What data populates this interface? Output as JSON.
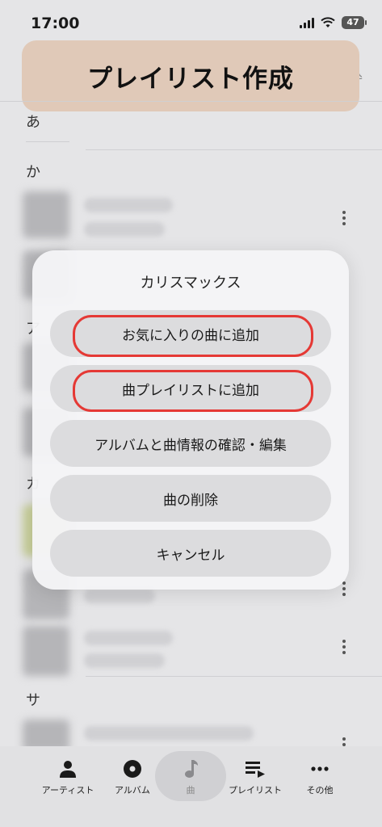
{
  "status_bar": {
    "time": "17:00",
    "battery": "47"
  },
  "top_nav": {
    "right_label": "取込"
  },
  "banner": {
    "title": "プレイリスト作成"
  },
  "list": {
    "sections": [
      "あ",
      "か",
      "ア",
      "カ",
      "サ"
    ]
  },
  "action_sheet": {
    "title": "カリスマックス",
    "buttons": [
      {
        "label": "お気に入りの曲に追加",
        "highlighted": true
      },
      {
        "label": "曲プレイリストに追加",
        "highlighted": true
      },
      {
        "label": "アルバムと曲情報の確認・編集",
        "highlighted": false
      },
      {
        "label": "曲の削除",
        "highlighted": false
      },
      {
        "label": "キャンセル",
        "highlighted": false
      }
    ]
  },
  "tab_bar": {
    "tabs": [
      {
        "label": "アーティスト",
        "icon": "person-icon"
      },
      {
        "label": "アルバム",
        "icon": "album-disc-icon"
      },
      {
        "label": "曲",
        "icon": "music-note-icon",
        "active": true
      },
      {
        "label": "プレイリスト",
        "icon": "playlist-icon"
      },
      {
        "label": "その他",
        "icon": "more-horizontal-icon"
      }
    ]
  },
  "colors": {
    "banner_bg": "#e0c9b8",
    "highlight_outline": "#e53935"
  }
}
